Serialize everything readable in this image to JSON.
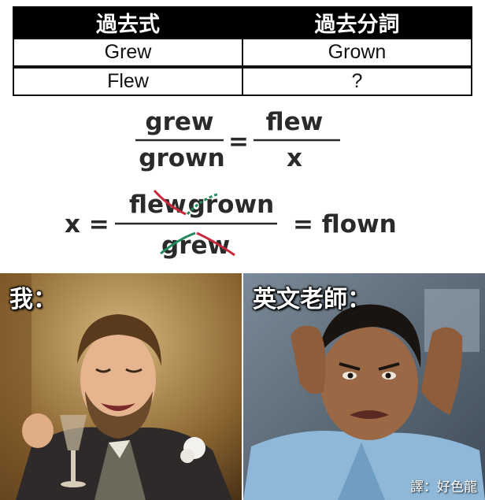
{
  "table": {
    "headers": [
      "過去式",
      "過去分詞"
    ],
    "rows": [
      [
        "Grew",
        "Grown"
      ],
      [
        "Flew",
        "?"
      ]
    ]
  },
  "equation1": {
    "num_left": "grew",
    "den_left": "grown",
    "equals": "=",
    "num_right": "flew",
    "den_right": "x"
  },
  "equation2": {
    "lhs": "x =",
    "num_a1": "fl",
    "num_a2": "ew",
    "num_b1": "gr",
    "num_b2": "own",
    "den_a": "gr",
    "den_b": "ew",
    "rhs": "= flown"
  },
  "panels": {
    "me_caption": "我：",
    "teacher_caption": "英文老師：",
    "credit": "譯：好色龍"
  },
  "colors": {
    "strike_red": "#c8283a",
    "strike_green": "#1f8a5a"
  }
}
